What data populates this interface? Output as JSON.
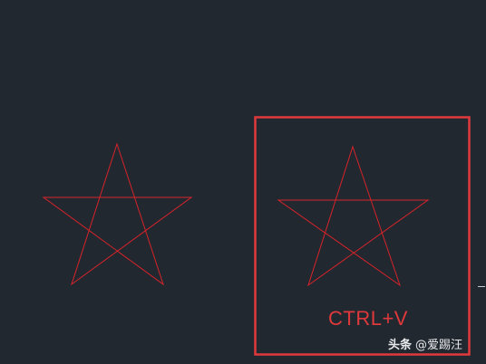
{
  "colors": {
    "background": "#212830",
    "star_stroke": "#d8232a",
    "selection_box": "#e0393c",
    "annotation_text": "#e0393c"
  },
  "annotation": {
    "paste_shortcut": "CTRL+V"
  },
  "watermark": {
    "source": "头条",
    "handle": "@爱踢汪"
  }
}
